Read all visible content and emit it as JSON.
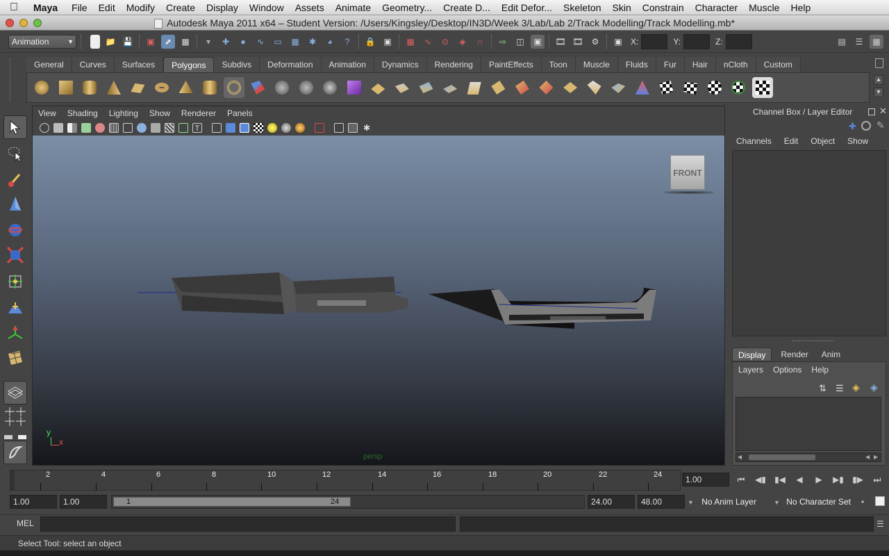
{
  "macmenu": {
    "app": "Maya",
    "items": [
      "File",
      "Edit",
      "Modify",
      "Create",
      "Display",
      "Window",
      "Assets",
      "Animate",
      "Geometry...",
      "Create D...",
      "Edit Defor...",
      "Skeleton",
      "Skin",
      "Constrain",
      "Character",
      "Muscle",
      "Help"
    ]
  },
  "window": {
    "title": "Autodesk Maya 2011 x64 – Student Version: /Users/Kingsley/Desktop/IN3D/Week 3/Lab/Lab 2/Track Modelling/Track Modelling.mb*"
  },
  "statusline": {
    "mode": "Animation",
    "x_label": "X:",
    "y_label": "Y:",
    "z_label": "Z:"
  },
  "shelf": {
    "tabs": [
      "General",
      "Curves",
      "Surfaces",
      "Polygons",
      "Subdivs",
      "Deformation",
      "Animation",
      "Dynamics",
      "Rendering",
      "PaintEffects",
      "Toon",
      "Muscle",
      "Fluids",
      "Fur",
      "Hair",
      "nCloth",
      "Custom"
    ],
    "active_tab": "Polygons"
  },
  "panel": {
    "menus": [
      "View",
      "Shading",
      "Lighting",
      "Show",
      "Renderer",
      "Panels"
    ],
    "camera_label": "persp",
    "viewcube_label": "FRONT",
    "axis_y": "y",
    "axis_x": "x"
  },
  "channelbox": {
    "title": "Channel Box / Layer Editor",
    "menus": [
      "Channels",
      "Edit",
      "Object",
      "Show"
    ],
    "layer_tabs": [
      "Display",
      "Render",
      "Anim"
    ],
    "active_layer_tab": "Display",
    "layer_menus": [
      "Layers",
      "Options",
      "Help"
    ]
  },
  "timeslider": {
    "ticks": [
      "2",
      "4",
      "6",
      "8",
      "10",
      "12",
      "14",
      "16",
      "18",
      "20",
      "22",
      "24"
    ],
    "current_time": "1.00"
  },
  "rangeslider": {
    "start_time": "1.00",
    "playback_start": "1.00",
    "range_start_label": "1",
    "range_end_label": "24",
    "playback_end": "24.00",
    "end_time": "48.00",
    "anim_layer": "No Anim Layer",
    "character_set": "No Character Set"
  },
  "cmdline": {
    "label": "MEL"
  },
  "helpline": {
    "text": "Select Tool: select an object"
  },
  "colors": {
    "viewport_top": "#7b8ea6",
    "viewport_bottom": "#15161a",
    "accent": "#5e5e5e"
  }
}
